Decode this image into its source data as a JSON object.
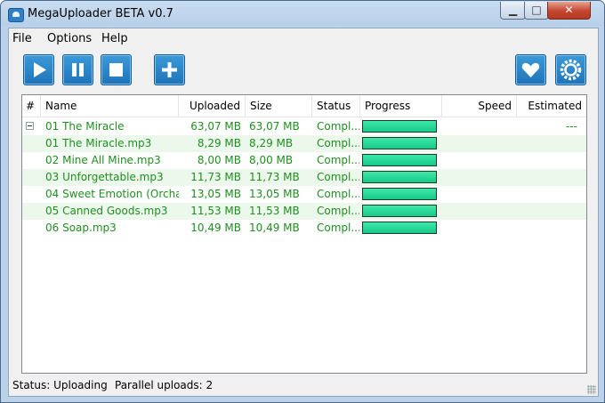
{
  "window": {
    "title": "MegaUploader BETA v0.7"
  },
  "titlebar_buttons": {
    "minimize": "▁",
    "maximize": "□",
    "close": "✕"
  },
  "menu": [
    "File",
    "Options",
    "Help"
  ],
  "toolbar": {
    "buttons": [
      {
        "name": "play-button",
        "icon": "play-icon"
      },
      {
        "name": "pause-button",
        "icon": "pause-icon"
      },
      {
        "name": "stop-button",
        "icon": "stop-icon"
      },
      {
        "name": "add-button",
        "icon": "plus-icon"
      },
      {
        "name": "favorite-button",
        "icon": "heart-icon"
      },
      {
        "name": "settings-button",
        "icon": "gear-icon"
      }
    ]
  },
  "table": {
    "columns": [
      "#",
      "Name",
      "Uploaded",
      "Size",
      "Status",
      "Progress",
      "Speed",
      "Estimated"
    ],
    "rows": [
      {
        "name": "01 The Miracle",
        "uploaded": "63,07 MB",
        "size": "63,07 MB",
        "status": "Compl...",
        "progress": 1.0,
        "speed": "",
        "estimated": "---",
        "is_group": true
      },
      {
        "name": "01 The Miracle.mp3",
        "uploaded": "8,29 MB",
        "size": "8,29 MB",
        "status": "Compl...",
        "progress": 1.0,
        "speed": "",
        "estimated": ""
      },
      {
        "name": "02 Mine All Mine.mp3",
        "uploaded": "8,00 MB",
        "size": "8,00 MB",
        "status": "Compl...",
        "progress": 1.0,
        "speed": "",
        "estimated": ""
      },
      {
        "name": "03 Unforgettable.mp3",
        "uploaded": "11,73 MB",
        "size": "11,73 MB",
        "status": "Compl...",
        "progress": 1.0,
        "speed": "",
        "estimated": ""
      },
      {
        "name": "04 Sweet Emotion (Orcha...",
        "uploaded": "13,05 MB",
        "size": "13,05 MB",
        "status": "Compl...",
        "progress": 1.0,
        "speed": "",
        "estimated": ""
      },
      {
        "name": "05 Canned Goods.mp3",
        "uploaded": "11,53 MB",
        "size": "11,53 MB",
        "status": "Compl...",
        "progress": 1.0,
        "speed": "",
        "estimated": ""
      },
      {
        "name": "06 Soap.mp3",
        "uploaded": "10,49 MB",
        "size": "10,49 MB",
        "status": "Compl...",
        "progress": 1.0,
        "speed": "",
        "estimated": ""
      }
    ]
  },
  "statusbar": {
    "status": "Status: Uploading",
    "parallel": "Parallel uploads: 2"
  },
  "colors": {
    "row_text": "#1f8f1f",
    "row_alt": "#ecf8ec",
    "progress": "#22d394",
    "toolbar_button": "#1f73b7"
  }
}
